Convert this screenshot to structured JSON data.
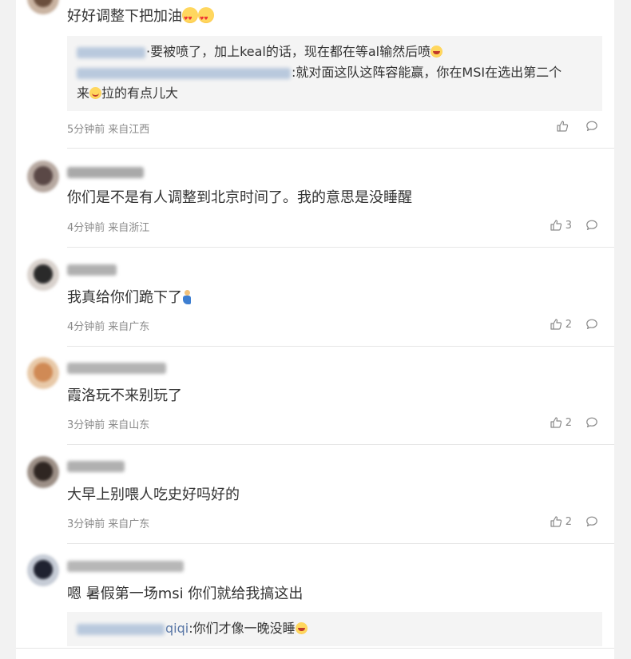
{
  "comments": [
    {
      "text": "好好调整下把加油",
      "time": "5分钟前",
      "location": "来自江西",
      "likes": "",
      "replies": [
        {
          "user_tail": "",
          "text": "·要被喷了，加上keal的话，现在都在等al输然后喷"
        },
        {
          "user_tail": "",
          "text": ":就对面这队这阵容能赢，你在MSI在选出第二个"
        },
        {
          "user_tail": "",
          "text_a": "来",
          "text_b": "拉的有点儿大"
        }
      ]
    },
    {
      "text": "你们是不是有人调整到北京时间了。我的意思是没睡醒",
      "time": "4分钟前",
      "location": "来自浙江",
      "likes": "3"
    },
    {
      "text": "我真给你们跪下了",
      "time": "4分钟前",
      "location": "来自广东",
      "likes": "2"
    },
    {
      "text": "霞洛玩不来别玩了",
      "time": "3分钟前",
      "location": "来自山东",
      "likes": "2"
    },
    {
      "text": "大早上别喂人吃史好吗好的",
      "time": "3分钟前",
      "location": "来自广东",
      "likes": "2"
    },
    {
      "text": "嗯 暑假第一场msi 你们就给我搞这出",
      "replies": [
        {
          "user_tail": "qiqi",
          "text": ":你们才像一晚没睡"
        }
      ]
    }
  ],
  "icons": {
    "like": "thumbs-up-icon",
    "reply": "comment-bubble-icon"
  }
}
